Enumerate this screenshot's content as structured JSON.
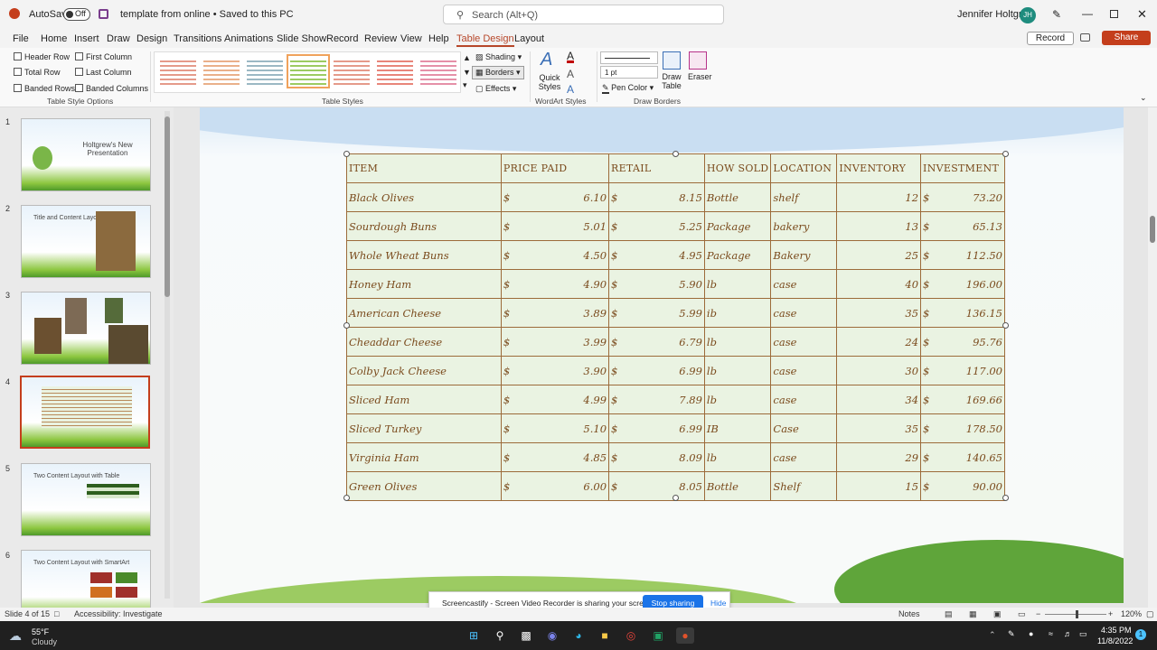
{
  "titlebar": {
    "autosave": "AutoSave",
    "toggle": "Off",
    "filename": "template from online • Saved to this PC",
    "search_placeholder": "Search (Alt+Q)",
    "user": "Jennifer Holtgrew",
    "user_initials": "JH"
  },
  "tabs": [
    "File",
    "Home",
    "Insert",
    "Draw",
    "Design",
    "Transitions",
    "Animations",
    "Slide Show",
    "Record",
    "Review",
    "View",
    "Help",
    "Table Design",
    "Layout"
  ],
  "active_tab": "Table Design",
  "actions": {
    "record": "Record",
    "share": "Share"
  },
  "ribbon": {
    "options": [
      "Header Row",
      "First Column",
      "Total Row",
      "Last Column",
      "Banded Rows",
      "Banded Columns"
    ],
    "options_label": "Table Style Options",
    "styles_label": "Table Styles",
    "shading": "Shading",
    "borders": "Borders",
    "effects": "Effects",
    "quick_styles": "Quick Styles",
    "wordart_label": "WordArt Styles",
    "pen_weight": "1 pt",
    "pen_color": "Pen Color",
    "draw_table": "Draw Table",
    "eraser": "Eraser",
    "draw_borders_label": "Draw Borders"
  },
  "thumbnails": [
    {
      "num": "1",
      "title": "Holtgrew's New Presentation"
    },
    {
      "num": "2",
      "title": "Title and Content Layo"
    },
    {
      "num": "3",
      "title": ""
    },
    {
      "num": "4",
      "title": ""
    },
    {
      "num": "5",
      "title": "Two Content Layout with Table"
    },
    {
      "num": "6",
      "title": "Two Content Layout with SmartArt"
    }
  ],
  "table": {
    "headers": [
      "ITEM",
      "PRICE PAID",
      "RETAIL",
      "HOW SOLD",
      "LOCATION",
      "INVENTORY",
      "INVESTMENT"
    ],
    "rows": [
      [
        "Black Olives",
        "6.10",
        "8.15",
        "Bottle",
        "shelf",
        "12",
        "73.20"
      ],
      [
        "Sourdough Buns",
        "5.01",
        "5.25",
        "Package",
        "bakery",
        "13",
        "65.13"
      ],
      [
        "Whole Wheat Buns",
        "4.50",
        "4.95",
        "Package",
        "Bakery",
        "25",
        "112.50"
      ],
      [
        "Honey Ham",
        "4.90",
        "5.90",
        "lb",
        "case",
        "40",
        "196.00"
      ],
      [
        "American Cheese",
        "3.89",
        "5.99",
        "ib",
        "case",
        "35",
        "136.15"
      ],
      [
        "Cheaddar Cheese",
        "3.99",
        "6.79",
        "lb",
        "case",
        "24",
        "95.76"
      ],
      [
        "Colby Jack Cheese",
        "3.90",
        "6.99",
        "lb",
        "case",
        "30",
        "117.00"
      ],
      [
        "Sliced Ham",
        "4.99",
        "7.89",
        "lb",
        "case",
        "34",
        "169.66"
      ],
      [
        "Sliced Turkey",
        "5.10",
        "6.99",
        "IB",
        "Case",
        "35",
        "178.50"
      ],
      [
        "Virginia Ham",
        "4.85",
        "8.09",
        "lb",
        "case",
        "29",
        "140.65"
      ],
      [
        "Green Olives",
        "6.00",
        "8.05",
        "Bottle",
        "Shelf",
        "15",
        "90.00"
      ]
    ],
    "currency": "$"
  },
  "status": {
    "slide": "Slide 4 of 15",
    "accessibility": "Accessibility: Investigate",
    "notes": "Notes",
    "zoom": "120%"
  },
  "banner": {
    "text": "Screencastify - Screen Video Recorder is sharing your screen.",
    "stop": "Stop sharing",
    "hide": "Hide"
  },
  "taskbar": {
    "temp": "55°F",
    "weather": "Cloudy",
    "time": "4:35 PM",
    "date": "11/8/2022",
    "notif": "1"
  }
}
